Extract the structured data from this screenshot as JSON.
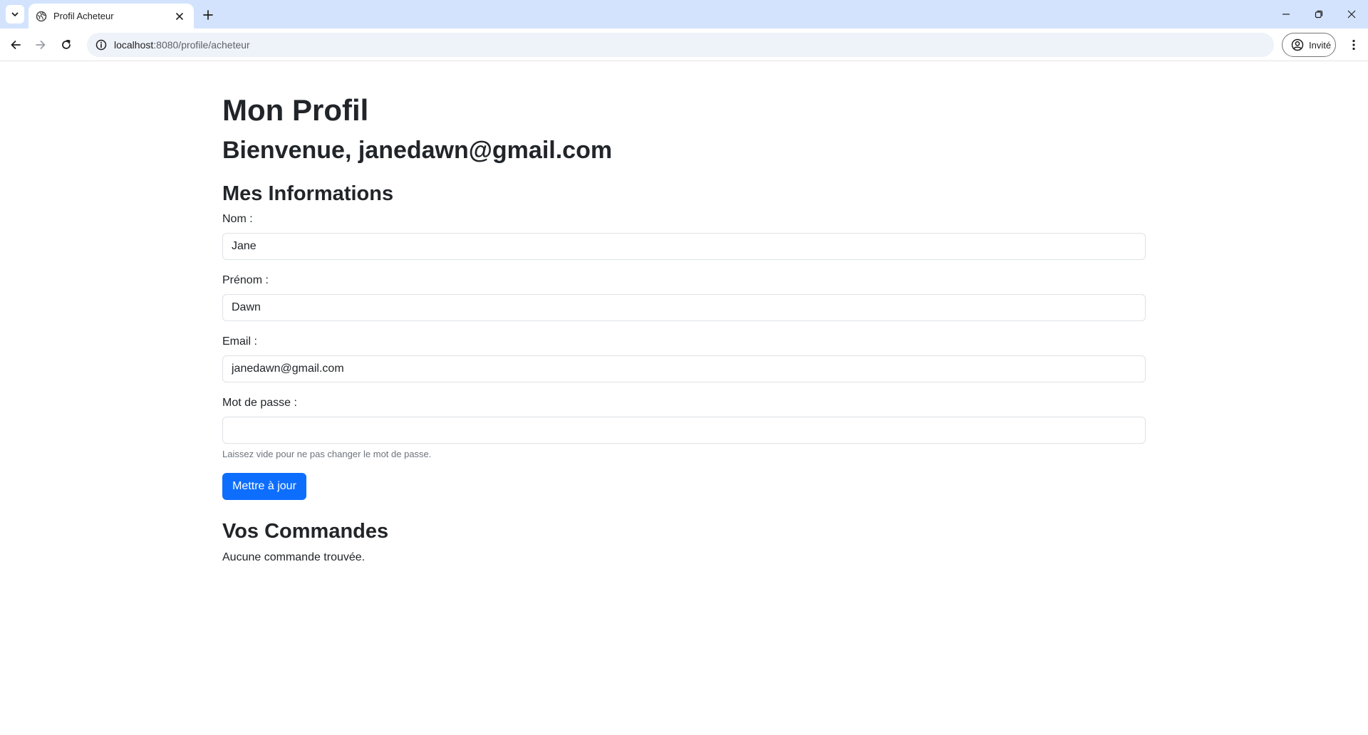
{
  "browser": {
    "tab": {
      "title": "Profil Acheteur"
    },
    "address": {
      "host": "localhost",
      "rest": ":8080/profile/acheteur"
    },
    "profile_label": "Invité",
    "icons": {
      "tab_search": "chevron-down-icon",
      "favicon": "globe-icon",
      "tab_close": "close-icon",
      "new_tab": "plus-icon",
      "minimize": "minimize-icon",
      "restore": "restore-icon",
      "close_window": "close-icon",
      "back": "arrow-left-icon",
      "forward": "arrow-right-icon",
      "reload": "reload-icon",
      "site_info": "info-icon",
      "profile": "account-circle-icon",
      "menu": "kebab-menu-icon"
    }
  },
  "page": {
    "title": "Mon Profil",
    "welcome": "Bienvenue, janedawn@gmail.com",
    "info_section": {
      "heading": "Mes Informations",
      "fields": [
        {
          "label": "Nom :",
          "value": "Jane"
        },
        {
          "label": "Prénom :",
          "value": "Dawn"
        },
        {
          "label": "Email :",
          "value": "janedawn@gmail.com"
        },
        {
          "label": "Mot de passe :",
          "value": ""
        }
      ],
      "password_help": "Laissez vide pour ne pas changer le mot de passe.",
      "submit_label": "Mettre à jour"
    },
    "orders_section": {
      "heading": "Vos Commandes",
      "empty_message": "Aucune commande trouvée."
    }
  },
  "colors": {
    "tabstrip": "#d3e3fd",
    "omnibox": "#eef2f9",
    "primary": "#0d6efd",
    "text": "#212529",
    "muted": "#6c757d"
  }
}
